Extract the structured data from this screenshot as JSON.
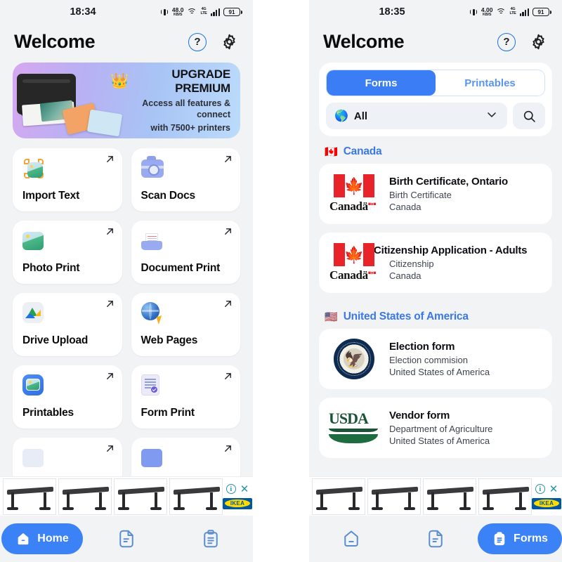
{
  "left": {
    "status": {
      "time": "18:34",
      "net_speed_value": "48.0",
      "net_speed_unit": "KB/S",
      "network": "LTE",
      "battery": "91"
    },
    "header": {
      "title": "Welcome",
      "help_icon": "help-circle-icon",
      "settings_icon": "gear-icon"
    },
    "promo": {
      "title": "UPGRADE PREMIUM",
      "line1": "Access all features & connect",
      "line2": "with 7500+ printers",
      "crown": "👑"
    },
    "tiles": [
      {
        "label": "Import Text",
        "icon": "import-text-icon"
      },
      {
        "label": "Scan Docs",
        "icon": "camera-icon"
      },
      {
        "label": "Photo Print",
        "icon": "photo-icon"
      },
      {
        "label": "Document Print",
        "icon": "document-tray-icon"
      },
      {
        "label": "Drive Upload",
        "icon": "google-drive-icon"
      },
      {
        "label": "Web Pages",
        "icon": "globe-cursor-icon"
      },
      {
        "label": "Printables",
        "icon": "printables-icon"
      },
      {
        "label": "Form Print",
        "icon": "form-document-icon"
      }
    ],
    "ad": {
      "info_label": "i",
      "close_label": "✕",
      "brand": "IKEA"
    },
    "nav": [
      {
        "label": "Home",
        "icon": "home-icon",
        "active": true
      },
      {
        "label": "",
        "icon": "document-icon",
        "active": false
      },
      {
        "label": "",
        "icon": "clipboard-icon",
        "active": false
      }
    ]
  },
  "right": {
    "status": {
      "time": "18:35",
      "net_speed_value": "4.00",
      "net_speed_unit": "KB/S",
      "network": "LTE",
      "battery": "91"
    },
    "header": {
      "title": "Welcome",
      "help_icon": "help-circle-icon",
      "settings_icon": "gear-icon"
    },
    "tabs": [
      {
        "label": "Forms",
        "active": true
      },
      {
        "label": "Printables",
        "active": false
      }
    ],
    "filter": {
      "value": "All",
      "globe": "🌎",
      "chevron_icon": "chevron-down-icon"
    },
    "search": {
      "icon": "search-icon"
    },
    "sections": [
      {
        "country": "Canada",
        "flag": "🇨🇦",
        "items": [
          {
            "title": "Birth Certificate, Ontario",
            "category": "Birth Certificate",
            "country": "Canada",
            "logo": "canada-wordmark",
            "clipped": false
          },
          {
            "title": "Citizenship Application - Adults",
            "category": "Citizenship",
            "country": "Canada",
            "logo": "canada-wordmark",
            "clipped": true
          }
        ]
      },
      {
        "country": "United States of America",
        "flag": "🇺🇸",
        "items": [
          {
            "title": "Election form",
            "category": "Election commision",
            "country": "United States of America",
            "logo": "us-dept-state-seal",
            "clipped": false
          },
          {
            "title": "Vendor form",
            "category": "Department of Agriculture",
            "country": "United States of America",
            "logo": "usda-logo",
            "clipped": false
          }
        ]
      }
    ],
    "ad": {
      "info_label": "i",
      "close_label": "✕",
      "brand": "IKEA"
    },
    "nav": [
      {
        "label": "",
        "icon": "home-icon",
        "active": false
      },
      {
        "label": "",
        "icon": "document-icon",
        "active": false
      },
      {
        "label": "Forms",
        "icon": "clipboard-icon",
        "active": true
      }
    ]
  },
  "colors": {
    "accent": "#3b82f6",
    "segment_active": "#3b7df5",
    "country_header": "#3b78e7",
    "bg": "#f2f3f5"
  }
}
